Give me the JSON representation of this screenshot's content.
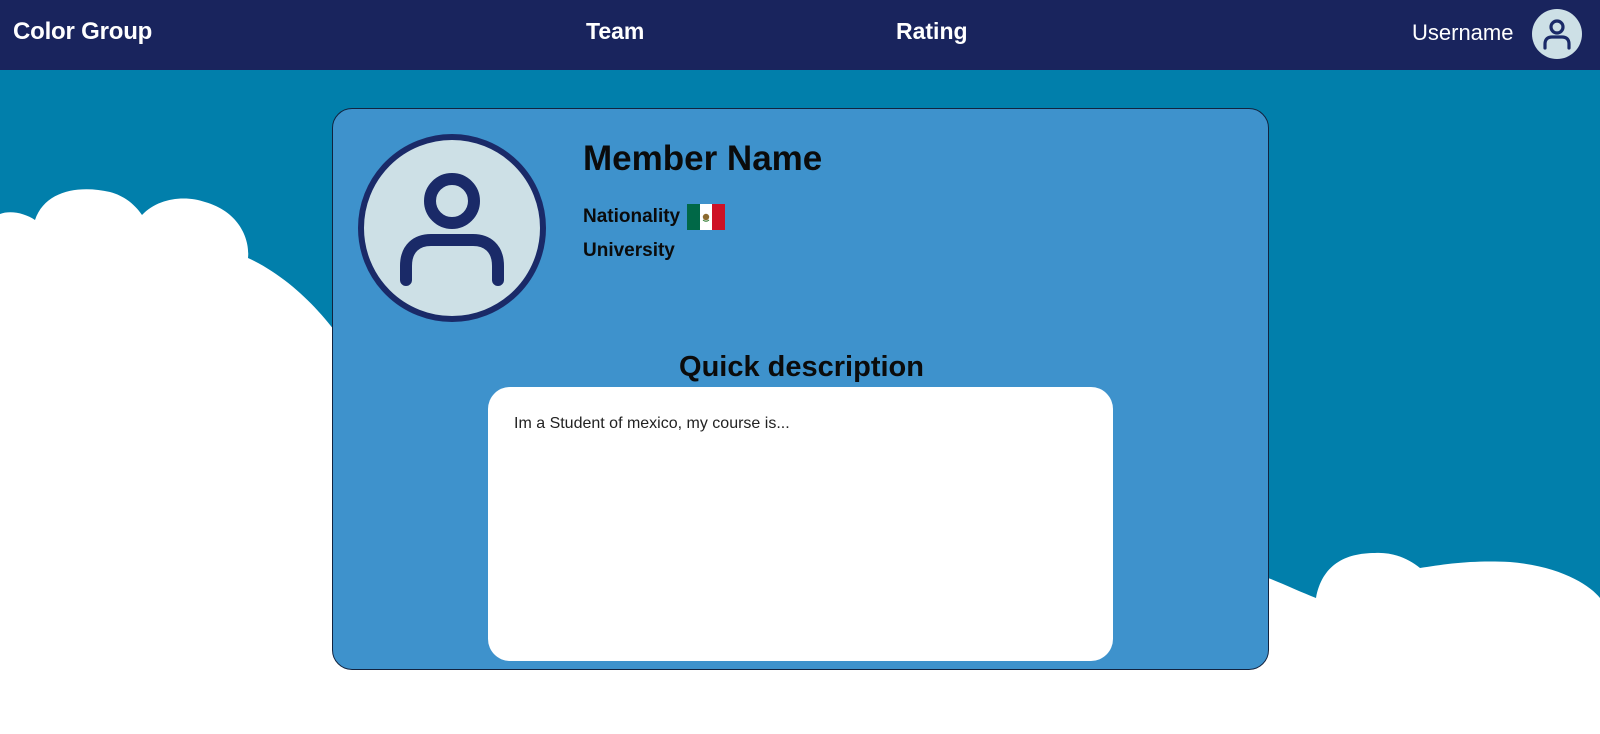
{
  "nav": {
    "brand": "Color Group",
    "links": [
      "Team",
      "Rating"
    ],
    "username": "Username"
  },
  "profile": {
    "member_name": "Member Name",
    "nationality_label": "Nationality",
    "university_label": "University"
  },
  "description": {
    "title": "Quick description",
    "text": "Im a Student of mexico, my course is..."
  },
  "icons": {
    "avatar": "user-icon",
    "profile_picture": "user-icon",
    "flag": "mexico-flag-icon"
  },
  "colors": {
    "navbar": "#19245d",
    "background": "#017fab",
    "card": "#3e92cc",
    "cloud": "#ffffff"
  }
}
